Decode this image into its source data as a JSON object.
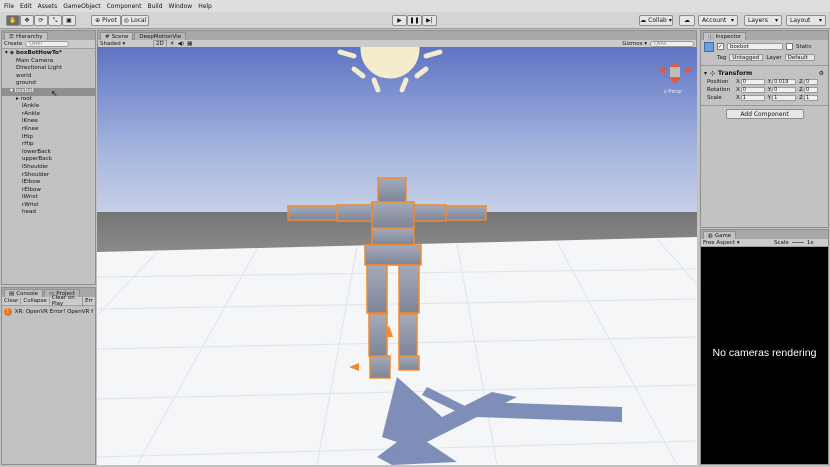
{
  "menu": [
    "File",
    "Edit",
    "Assets",
    "GameObject",
    "Component",
    "Build",
    "Window",
    "Help"
  ],
  "toolbar": {
    "pivot_label": "Pivot",
    "local_label": "Local",
    "collab_label": "Collab",
    "account_label": "Account",
    "layers_label": "Layers",
    "layout_label": "Layout"
  },
  "hierarchy": {
    "tab_label": "Hierarchy",
    "create_label": "Create",
    "search_placeholder": "Q▾All",
    "scene_name": "boxBotHowTo*",
    "items": [
      "Main Camera",
      "Directional Light",
      "world",
      "ground"
    ],
    "selected": "boxbot",
    "root_label": "root",
    "children": [
      "lAnkle",
      "rAnkle",
      "lKnee",
      "rKnee",
      "lHip",
      "rHip",
      "lowerBack",
      "upperBack",
      "lShoulder",
      "rShoulder",
      "lElbow",
      "rElbow",
      "lWrist",
      "rWrist",
      "head"
    ]
  },
  "console": {
    "tab_console": "Console",
    "tab_project": "Project",
    "buttons": [
      "Clear",
      "Collapse",
      "Clear on Play",
      "Err"
    ],
    "message": "XR: OpenVR Error! OpenVR fa"
  },
  "scene": {
    "tab_scene": "Scene",
    "tab_other": "DeepMotionVie",
    "shading": "Shaded",
    "mode_2d": "2D",
    "gizmos": "Gizmos",
    "search_placeholder": "Q▾All",
    "persp_label": "≡ Persp"
  },
  "inspector": {
    "tab_label": "Inspector",
    "object_name": "boxbot",
    "static_label": "Static",
    "tag_label": "Tag",
    "tag_value": "Untagged",
    "layer_label": "Layer",
    "layer_value": "Default",
    "transform_label": "Transform",
    "position_label": "Position",
    "rotation_label": "Rotation",
    "scale_label": "Scale",
    "position": {
      "x": "0",
      "y": "0.019",
      "z": "0"
    },
    "rotation": {
      "x": "0",
      "y": "0",
      "z": "0"
    },
    "scale": {
      "x": "1",
      "y": "1",
      "z": "1"
    },
    "add_component": "Add Component"
  },
  "game": {
    "tab_label": "Game",
    "aspect": "Free Aspect",
    "scale_label": "Scale",
    "scale_value": "1x",
    "message": "No cameras rendering"
  },
  "colors": {
    "selection_outline": "#f08a2c",
    "sky_top": "#5f73c4",
    "ground": "#f4f6f8"
  }
}
